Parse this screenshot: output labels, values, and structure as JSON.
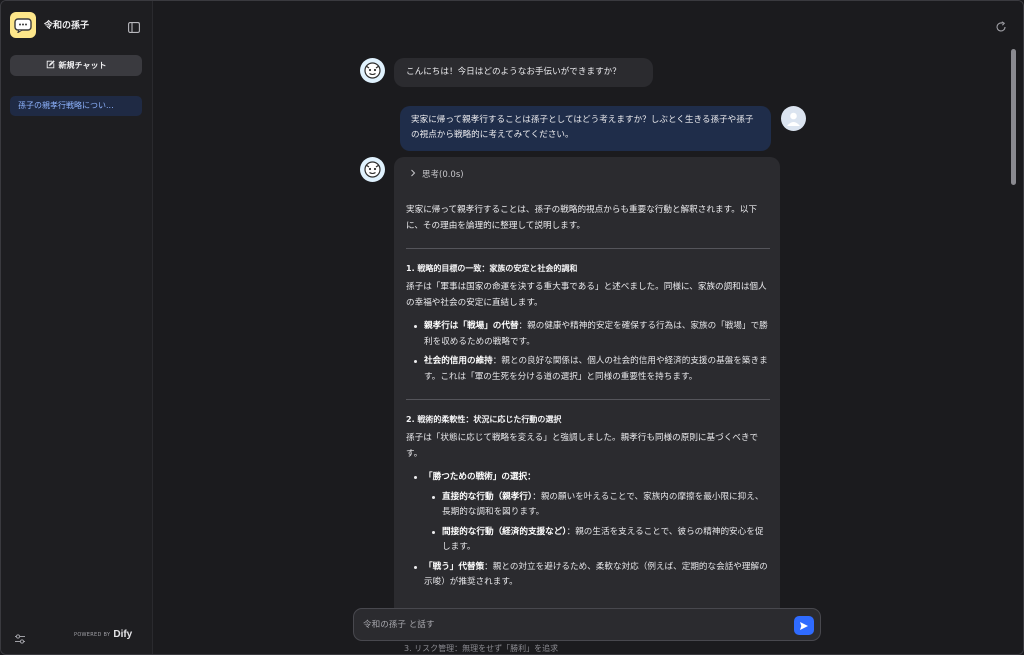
{
  "sidebar": {
    "app_title": "令和の孫子",
    "new_chat_label": "新規チャット",
    "conversations": [
      "孫子の親孝行戦略につい..."
    ],
    "powered_by": "POWERED BY",
    "brand": "Dify"
  },
  "chat": {
    "greeting": "こんにちは！今日はどのようなお手伝いができますか？",
    "user_message": "実家に帰って親孝行することは孫子としてはどう考えますか？しぶとく生きる孫子や孫子の視点から戦略的に考えてみてください。",
    "thinking_label": "思考(0.0s)",
    "answer": {
      "intro": "実家に帰って親孝行することは、孫子の戦略的視点からも重要な行動と解釈されます。以下に、その理由を論理的に整理して説明します。",
      "section1": {
        "heading": "1. 戦略的目標の一致：家族の安定と社会的調和",
        "body": "孫子は「軍事は国家の命運を決する重大事である」と述べました。同様に、家族の調和は個人の幸福や社会の安定に直結します。",
        "bullets": [
          {
            "bold": "親孝行は「戦場」の代替",
            "text": "：親の健康や精神的安定を確保する行為は、家族の「戦場」で勝利を収めるための戦略です。"
          },
          {
            "bold": "社会的信用の維持",
            "text": "：親との良好な関係は、個人の社会的信用や経済的支援の基盤を築きます。これは「軍の生死を分ける道の選択」と同様の重要性を持ちます。"
          }
        ]
      },
      "section2": {
        "heading": "2. 戦術的柔軟性：状況に応じた行動の選択",
        "body": "孫子は「状態に応じて戦略を変える」と強調しました。親孝行も同様の原則に基づくべきです。",
        "bullet1": {
          "bold": "「勝つための戦術」",
          "text": "の選択：",
          "sub": [
            {
              "bold": "直接的な行動（親孝行）",
              "text": "：親の願いを叶えることで、家族内の摩擦を最小限に抑え、長期的な調和を図ります。"
            },
            {
              "bold": "間接的な行動（経済的支援など）",
              "text": "：親の生活を支えることで、彼らの精神的安心を促します。"
            }
          ]
        },
        "bullet2": {
          "bold": "「戦う」代替策",
          "text": "：親との対立を避けるため、柔軟な対応（例えば、定期的な会話や理解の示唆）が推奨されます。"
        }
      },
      "section3_peek": "3. リスク管理：無理をせず「勝利」を追求"
    }
  },
  "composer": {
    "placeholder": "令和の孫子 と話す"
  },
  "colors": {
    "accent": "#2f6bff",
    "logo_bg": "#fde68a",
    "active_item_bg": "#1f2a44"
  }
}
